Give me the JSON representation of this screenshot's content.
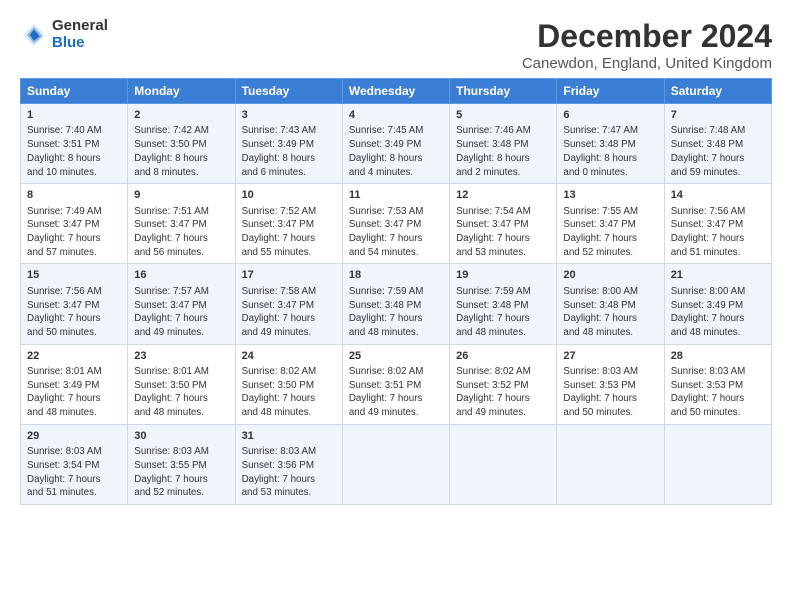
{
  "header": {
    "logo_general": "General",
    "logo_blue": "Blue",
    "title": "December 2024",
    "subtitle": "Canewdon, England, United Kingdom"
  },
  "columns": [
    "Sunday",
    "Monday",
    "Tuesday",
    "Wednesday",
    "Thursday",
    "Friday",
    "Saturday"
  ],
  "weeks": [
    [
      {
        "day": "1",
        "lines": [
          "Sunrise: 7:40 AM",
          "Sunset: 3:51 PM",
          "Daylight: 8 hours",
          "and 10 minutes."
        ]
      },
      {
        "day": "2",
        "lines": [
          "Sunrise: 7:42 AM",
          "Sunset: 3:50 PM",
          "Daylight: 8 hours",
          "and 8 minutes."
        ]
      },
      {
        "day": "3",
        "lines": [
          "Sunrise: 7:43 AM",
          "Sunset: 3:49 PM",
          "Daylight: 8 hours",
          "and 6 minutes."
        ]
      },
      {
        "day": "4",
        "lines": [
          "Sunrise: 7:45 AM",
          "Sunset: 3:49 PM",
          "Daylight: 8 hours",
          "and 4 minutes."
        ]
      },
      {
        "day": "5",
        "lines": [
          "Sunrise: 7:46 AM",
          "Sunset: 3:48 PM",
          "Daylight: 8 hours",
          "and 2 minutes."
        ]
      },
      {
        "day": "6",
        "lines": [
          "Sunrise: 7:47 AM",
          "Sunset: 3:48 PM",
          "Daylight: 8 hours",
          "and 0 minutes."
        ]
      },
      {
        "day": "7",
        "lines": [
          "Sunrise: 7:48 AM",
          "Sunset: 3:48 PM",
          "Daylight: 7 hours",
          "and 59 minutes."
        ]
      }
    ],
    [
      {
        "day": "8",
        "lines": [
          "Sunrise: 7:49 AM",
          "Sunset: 3:47 PM",
          "Daylight: 7 hours",
          "and 57 minutes."
        ]
      },
      {
        "day": "9",
        "lines": [
          "Sunrise: 7:51 AM",
          "Sunset: 3:47 PM",
          "Daylight: 7 hours",
          "and 56 minutes."
        ]
      },
      {
        "day": "10",
        "lines": [
          "Sunrise: 7:52 AM",
          "Sunset: 3:47 PM",
          "Daylight: 7 hours",
          "and 55 minutes."
        ]
      },
      {
        "day": "11",
        "lines": [
          "Sunrise: 7:53 AM",
          "Sunset: 3:47 PM",
          "Daylight: 7 hours",
          "and 54 minutes."
        ]
      },
      {
        "day": "12",
        "lines": [
          "Sunrise: 7:54 AM",
          "Sunset: 3:47 PM",
          "Daylight: 7 hours",
          "and 53 minutes."
        ]
      },
      {
        "day": "13",
        "lines": [
          "Sunrise: 7:55 AM",
          "Sunset: 3:47 PM",
          "Daylight: 7 hours",
          "and 52 minutes."
        ]
      },
      {
        "day": "14",
        "lines": [
          "Sunrise: 7:56 AM",
          "Sunset: 3:47 PM",
          "Daylight: 7 hours",
          "and 51 minutes."
        ]
      }
    ],
    [
      {
        "day": "15",
        "lines": [
          "Sunrise: 7:56 AM",
          "Sunset: 3:47 PM",
          "Daylight: 7 hours",
          "and 50 minutes."
        ]
      },
      {
        "day": "16",
        "lines": [
          "Sunrise: 7:57 AM",
          "Sunset: 3:47 PM",
          "Daylight: 7 hours",
          "and 49 minutes."
        ]
      },
      {
        "day": "17",
        "lines": [
          "Sunrise: 7:58 AM",
          "Sunset: 3:47 PM",
          "Daylight: 7 hours",
          "and 49 minutes."
        ]
      },
      {
        "day": "18",
        "lines": [
          "Sunrise: 7:59 AM",
          "Sunset: 3:48 PM",
          "Daylight: 7 hours",
          "and 48 minutes."
        ]
      },
      {
        "day": "19",
        "lines": [
          "Sunrise: 7:59 AM",
          "Sunset: 3:48 PM",
          "Daylight: 7 hours",
          "and 48 minutes."
        ]
      },
      {
        "day": "20",
        "lines": [
          "Sunrise: 8:00 AM",
          "Sunset: 3:48 PM",
          "Daylight: 7 hours",
          "and 48 minutes."
        ]
      },
      {
        "day": "21",
        "lines": [
          "Sunrise: 8:00 AM",
          "Sunset: 3:49 PM",
          "Daylight: 7 hours",
          "and 48 minutes."
        ]
      }
    ],
    [
      {
        "day": "22",
        "lines": [
          "Sunrise: 8:01 AM",
          "Sunset: 3:49 PM",
          "Daylight: 7 hours",
          "and 48 minutes."
        ]
      },
      {
        "day": "23",
        "lines": [
          "Sunrise: 8:01 AM",
          "Sunset: 3:50 PM",
          "Daylight: 7 hours",
          "and 48 minutes."
        ]
      },
      {
        "day": "24",
        "lines": [
          "Sunrise: 8:02 AM",
          "Sunset: 3:50 PM",
          "Daylight: 7 hours",
          "and 48 minutes."
        ]
      },
      {
        "day": "25",
        "lines": [
          "Sunrise: 8:02 AM",
          "Sunset: 3:51 PM",
          "Daylight: 7 hours",
          "and 49 minutes."
        ]
      },
      {
        "day": "26",
        "lines": [
          "Sunrise: 8:02 AM",
          "Sunset: 3:52 PM",
          "Daylight: 7 hours",
          "and 49 minutes."
        ]
      },
      {
        "day": "27",
        "lines": [
          "Sunrise: 8:03 AM",
          "Sunset: 3:53 PM",
          "Daylight: 7 hours",
          "and 50 minutes."
        ]
      },
      {
        "day": "28",
        "lines": [
          "Sunrise: 8:03 AM",
          "Sunset: 3:53 PM",
          "Daylight: 7 hours",
          "and 50 minutes."
        ]
      }
    ],
    [
      {
        "day": "29",
        "lines": [
          "Sunrise: 8:03 AM",
          "Sunset: 3:54 PM",
          "Daylight: 7 hours",
          "and 51 minutes."
        ]
      },
      {
        "day": "30",
        "lines": [
          "Sunrise: 8:03 AM",
          "Sunset: 3:55 PM",
          "Daylight: 7 hours",
          "and 52 minutes."
        ]
      },
      {
        "day": "31",
        "lines": [
          "Sunrise: 8:03 AM",
          "Sunset: 3:56 PM",
          "Daylight: 7 hours",
          "and 53 minutes."
        ]
      },
      null,
      null,
      null,
      null
    ]
  ]
}
